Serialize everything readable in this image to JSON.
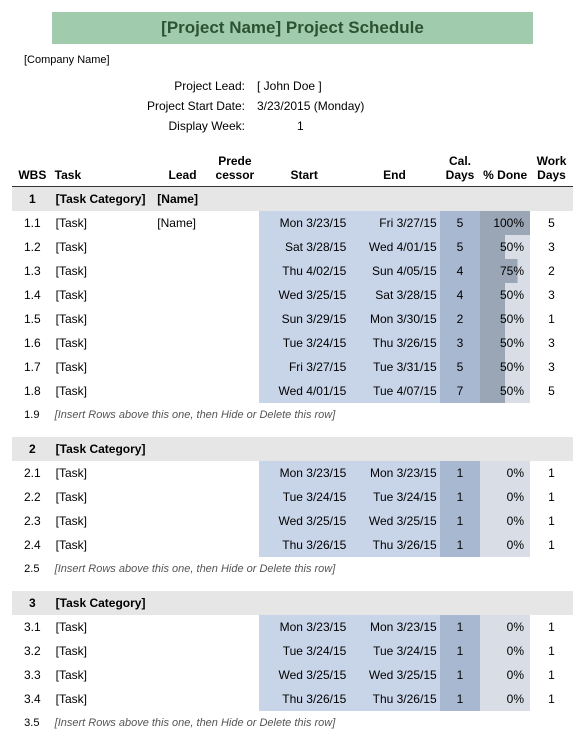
{
  "title": "[Project Name] Project Schedule",
  "company": "[Company Name]",
  "info": {
    "lead_label": "Project Lead:",
    "lead_value": "[ John Doe ]",
    "start_label": "Project Start Date:",
    "start_value": "3/23/2015 (Monday)",
    "week_label": "Display Week:",
    "week_value": "1"
  },
  "headers": {
    "wbs": "WBS",
    "task": "Task",
    "lead": "Lead",
    "pred": "Prede cessor",
    "start": "Start",
    "end": "End",
    "cal_days": "Cal. Days",
    "pct_done": "% Done",
    "work_days": "Work Days"
  },
  "hint_text": "[Insert Rows above this one, then Hide or Delete this row]",
  "groups": [
    {
      "wbs": "1",
      "category": "[Task Category]",
      "lead": "[Name]",
      "rows": [
        {
          "wbs": "1.1",
          "task": "[Task]",
          "lead": "[Name]",
          "start": "Mon 3/23/15",
          "end": "Fri 3/27/15",
          "cal": "5",
          "pct": "100%",
          "pctv": 100,
          "work": "5"
        },
        {
          "wbs": "1.2",
          "task": "[Task]",
          "lead": "",
          "start": "Sat 3/28/15",
          "end": "Wed 4/01/15",
          "cal": "5",
          "pct": "50%",
          "pctv": 50,
          "work": "3"
        },
        {
          "wbs": "1.3",
          "task": "[Task]",
          "lead": "",
          "start": "Thu 4/02/15",
          "end": "Sun 4/05/15",
          "cal": "4",
          "pct": "75%",
          "pctv": 75,
          "work": "2"
        },
        {
          "wbs": "1.4",
          "task": "[Task]",
          "lead": "",
          "start": "Wed 3/25/15",
          "end": "Sat 3/28/15",
          "cal": "4",
          "pct": "50%",
          "pctv": 50,
          "work": "3"
        },
        {
          "wbs": "1.5",
          "task": "[Task]",
          "lead": "",
          "start": "Sun 3/29/15",
          "end": "Mon 3/30/15",
          "cal": "2",
          "pct": "50%",
          "pctv": 50,
          "work": "1"
        },
        {
          "wbs": "1.6",
          "task": "[Task]",
          "lead": "",
          "start": "Tue 3/24/15",
          "end": "Thu 3/26/15",
          "cal": "3",
          "pct": "50%",
          "pctv": 50,
          "work": "3"
        },
        {
          "wbs": "1.7",
          "task": "[Task]",
          "lead": "",
          "start": "Fri 3/27/15",
          "end": "Tue 3/31/15",
          "cal": "5",
          "pct": "50%",
          "pctv": 50,
          "work": "3"
        },
        {
          "wbs": "1.8",
          "task": "[Task]",
          "lead": "",
          "start": "Wed 4/01/15",
          "end": "Tue 4/07/15",
          "cal": "7",
          "pct": "50%",
          "pctv": 50,
          "work": "5"
        }
      ],
      "hint_wbs": "1.9"
    },
    {
      "wbs": "2",
      "category": "[Task Category]",
      "lead": "",
      "rows": [
        {
          "wbs": "2.1",
          "task": "[Task]",
          "lead": "",
          "start": "Mon 3/23/15",
          "end": "Mon 3/23/15",
          "cal": "1",
          "pct": "0%",
          "pctv": 0,
          "work": "1"
        },
        {
          "wbs": "2.2",
          "task": "[Task]",
          "lead": "",
          "start": "Tue 3/24/15",
          "end": "Tue 3/24/15",
          "cal": "1",
          "pct": "0%",
          "pctv": 0,
          "work": "1"
        },
        {
          "wbs": "2.3",
          "task": "[Task]",
          "lead": "",
          "start": "Wed 3/25/15",
          "end": "Wed 3/25/15",
          "cal": "1",
          "pct": "0%",
          "pctv": 0,
          "work": "1"
        },
        {
          "wbs": "2.4",
          "task": "[Task]",
          "lead": "",
          "start": "Thu 3/26/15",
          "end": "Thu 3/26/15",
          "cal": "1",
          "pct": "0%",
          "pctv": 0,
          "work": "1"
        }
      ],
      "hint_wbs": "2.5"
    },
    {
      "wbs": "3",
      "category": "[Task Category]",
      "lead": "",
      "rows": [
        {
          "wbs": "3.1",
          "task": "[Task]",
          "lead": "",
          "start": "Mon 3/23/15",
          "end": "Mon 3/23/15",
          "cal": "1",
          "pct": "0%",
          "pctv": 0,
          "work": "1"
        },
        {
          "wbs": "3.2",
          "task": "[Task]",
          "lead": "",
          "start": "Tue 3/24/15",
          "end": "Tue 3/24/15",
          "cal": "1",
          "pct": "0%",
          "pctv": 0,
          "work": "1"
        },
        {
          "wbs": "3.3",
          "task": "[Task]",
          "lead": "",
          "start": "Wed 3/25/15",
          "end": "Wed 3/25/15",
          "cal": "1",
          "pct": "0%",
          "pctv": 0,
          "work": "1"
        },
        {
          "wbs": "3.4",
          "task": "[Task]",
          "lead": "",
          "start": "Thu 3/26/15",
          "end": "Thu 3/26/15",
          "cal": "1",
          "pct": "0%",
          "pctv": 0,
          "work": "1"
        }
      ],
      "hint_wbs": "3.5"
    }
  ]
}
